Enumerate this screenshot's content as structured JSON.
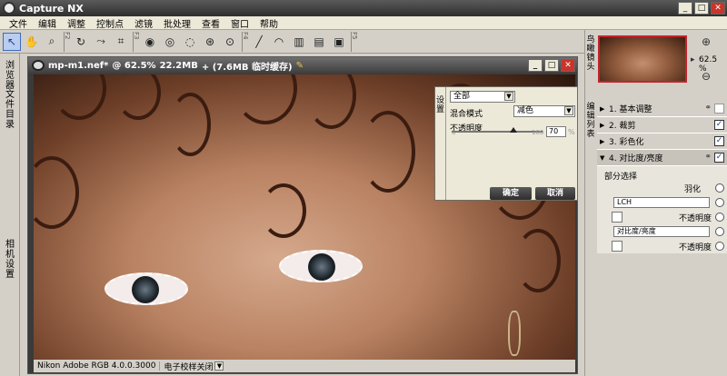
{
  "app": {
    "title": "Capture NX"
  },
  "menu": [
    "文件",
    "编辑",
    "调整",
    "控制点",
    "滤镜",
    "批处理",
    "查看",
    "窗口",
    "帮助"
  ],
  "toolbar": {
    "tools": [
      "direct-select-icon",
      "hand-icon",
      "zoom-icon",
      "rotate-icon",
      "straighten-icon",
      "crop-icon",
      "black-point-icon",
      "white-point-icon",
      "neutral-point-icon",
      "color-point-icon",
      "red-eye-icon",
      "brush-icon",
      "lasso-icon",
      "gradient-icon",
      "fill-icon",
      "selection-icon"
    ],
    "separators": [
      "F2",
      "F3",
      "F4",
      "F5"
    ]
  },
  "left_tabs": {
    "browser": "浏览器",
    "file_dir": "文件目录",
    "camera_settings": "相机设置"
  },
  "document": {
    "filename": "mp-m1.nef*",
    "zoom": "@ 62.5%",
    "size": "22.2MB",
    "cache": "+ (7.6MB 临时缓存)",
    "status_profile": "Nikon Adobe RGB 4.0.0.3000",
    "status_softproof": "电子校样关闭"
  },
  "settings_popup": {
    "tab": "设置",
    "selection": "全部",
    "blend_label": "混合模式",
    "blend_value": "减色",
    "opacity_label": "不透明度",
    "slider_min": "0",
    "slider_max": "100",
    "opacity_value": "70",
    "opacity_unit": "%",
    "ok": "确定",
    "cancel": "取消"
  },
  "right_panel": {
    "birdseye_tab": "鸟瞰镜头",
    "edit_tab": "编辑列表",
    "zoom_value": "62.5 %",
    "steps": [
      {
        "label": "1. 基本调整",
        "checked": false
      },
      {
        "label": "2. 裁剪",
        "checked": true
      },
      {
        "label": "3. 彩色化",
        "checked": true
      },
      {
        "label": "4. 对比度/亮度",
        "checked": true
      }
    ],
    "sub": {
      "selective": "部分选择",
      "feather": "羽化",
      "lch": "LCH",
      "opacity1": "不透明度",
      "contrast": "对比度/亮度",
      "opacity2": "不透明度"
    }
  }
}
